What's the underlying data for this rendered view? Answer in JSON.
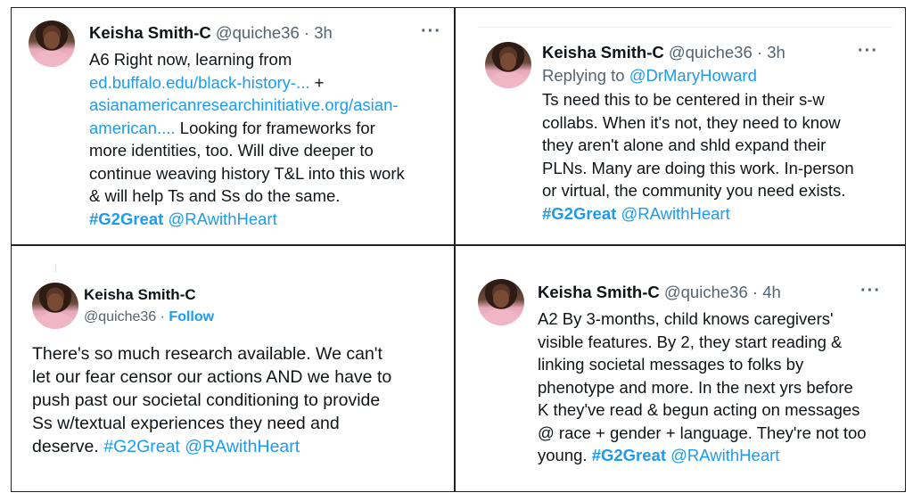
{
  "tweets": [
    {
      "name": "Keisha Smith-C",
      "handle": "@quiche36",
      "sep": "·",
      "time": "3h",
      "more": "···",
      "lines": [
        "A6 Right now, learning from",
        "ed.buffalo.edu/black-history-...",
        " +",
        "asianamericanresearchinitiative.org/asian-",
        "american....",
        " Looking for frameworks for",
        "more identities, too. Will dive deeper to",
        "continue weaving history T&L into this work",
        "& will help Ts and Ss do the same.",
        "#G2Great",
        "@RAwithHeart"
      ]
    },
    {
      "name": "Keisha Smith-C",
      "handle": "@quiche36",
      "sep": "·",
      "time": "3h",
      "more": "···",
      "replying_prefix": "Replying to",
      "replying_to": "@DrMaryHoward",
      "lines": [
        "Ts need this to be centered in their s-w",
        "collabs. When it's not, they need to know",
        "they aren't alone and shld expand their",
        "PLNs.  Many are doing this work. In-person",
        "or virtual, the community you need exists.",
        "#G2Great",
        "@RAwithHeart"
      ]
    },
    {
      "name": "Keisha Smith-C",
      "handle": "@quiche36",
      "sep": "·",
      "follow": "Follow",
      "lines": [
        "There's so much research available. We can't",
        "let our fear censor our actions AND we have to",
        "push past our societal conditioning to provide",
        "Ss w/textual experiences they need and",
        "deserve.",
        "#G2Great",
        "@RAwithHeart"
      ]
    },
    {
      "name": "Keisha Smith-C",
      "handle": "@quiche36",
      "sep": "·",
      "time": "4h",
      "more": "···",
      "lines": [
        "A2 By 3-months, child knows caregivers'",
        "visible features. By 2, they start reading &",
        "linking societal messages to folks by",
        "phenotype and more. In the next yrs before",
        "K they've read & begun acting on messages",
        "@ race + gender + language. They're not too",
        "young.",
        "#G2Great",
        "@RAwithHeart"
      ]
    }
  ]
}
